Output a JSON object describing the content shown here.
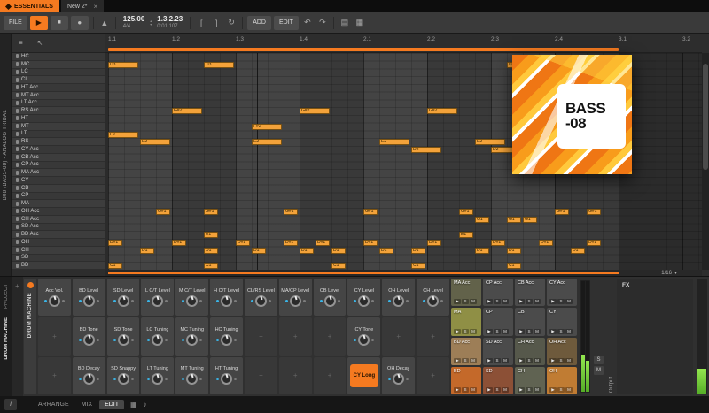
{
  "titlebar": {
    "badge": "ESSENTIALS",
    "tab": "New 2*",
    "close_glyph": "×"
  },
  "transport": {
    "file": "FILE",
    "play_glyph": "▶",
    "stop_glyph": "■",
    "record_glyph": "●",
    "metronome_glyph": "▲",
    "tempo": "125.00",
    "time_signature": "4/4",
    "position": "1.3.2.23",
    "time": "0:01.107",
    "punch_in_glyph": "[",
    "punch_out_glyph": "]",
    "loop_glyph": "↻",
    "add": "ADD",
    "edit": "EDIT",
    "undo_glyph": "↶",
    "redo_glyph": "↷",
    "layers_glyph": "▤",
    "grid_glyph": "▦",
    "stepper_up": "▴",
    "stepper_down": "▾"
  },
  "edit_view": {
    "track_vertical_label": "B08 (BASS-08) - ANALOG TRIBAL",
    "corner_menu_glyph": "≡",
    "corner_tool_glyph": "↖",
    "timeline": [
      "1.1",
      "1.2",
      "1.3",
      "1.4",
      "2.1",
      "2.2",
      "2.3",
      "2.4",
      "3.1",
      "3.2"
    ],
    "grid_value": "1/16",
    "grid_chevron": "▾",
    "lanes": [
      "HC",
      "MC",
      "LC",
      "CL",
      "HT Acc",
      "MT Acc",
      "LT Acc",
      "RS Acc",
      "HT",
      "MT",
      "LT",
      "RS",
      "CY Acc",
      "CB Acc",
      "CP Acc",
      "MA Acc",
      "CY",
      "CB",
      "CP",
      "MA",
      "OH Acc",
      "CH Acc",
      "SD Acc",
      "BD Acc",
      "OH",
      "CH",
      "SD",
      "BD"
    ],
    "notes": [
      {
        "label": "D3",
        "row": 1,
        "col": 0,
        "len": 2
      },
      {
        "label": "D3",
        "row": 1,
        "col": 6,
        "len": 2
      },
      {
        "label": "D3",
        "row": 1,
        "col": 25,
        "len": 2
      },
      {
        "label": "G#2",
        "row": 7,
        "col": 4,
        "len": 2
      },
      {
        "label": "G#2",
        "row": 7,
        "col": 12,
        "len": 2
      },
      {
        "label": "G#2",
        "row": 7,
        "col": 20,
        "len": 2
      },
      {
        "label": "F#2",
        "row": 9,
        "col": 9,
        "len": 2
      },
      {
        "label": "F2",
        "row": 10,
        "col": 0,
        "len": 2
      },
      {
        "label": "E2",
        "row": 11,
        "col": 2,
        "len": 2
      },
      {
        "label": "E2",
        "row": 11,
        "col": 9,
        "len": 2
      },
      {
        "label": "E2",
        "row": 11,
        "col": 17,
        "len": 2
      },
      {
        "label": "E2",
        "row": 11,
        "col": 23,
        "len": 2
      },
      {
        "label": "D2",
        "row": 12,
        "col": 19,
        "len": 2
      },
      {
        "label": "D2",
        "row": 12,
        "col": 24,
        "len": 2
      },
      {
        "label": "G#1",
        "row": 20,
        "col": 3,
        "len": 1
      },
      {
        "label": "G#1",
        "row": 20,
        "col": 6,
        "len": 1
      },
      {
        "label": "G#1",
        "row": 20,
        "col": 11,
        "len": 1
      },
      {
        "label": "G#1",
        "row": 20,
        "col": 16,
        "len": 1
      },
      {
        "label": "G#1",
        "row": 20,
        "col": 22,
        "len": 1
      },
      {
        "label": "G#1",
        "row": 20,
        "col": 28,
        "len": 1
      },
      {
        "label": "G#1",
        "row": 20,
        "col": 30,
        "len": 1
      },
      {
        "label": "G1",
        "row": 21,
        "col": 23,
        "len": 1
      },
      {
        "label": "G1",
        "row": 21,
        "col": 25,
        "len": 1
      },
      {
        "label": "G1",
        "row": 21,
        "col": 26,
        "len": 1
      },
      {
        "label": "E1",
        "row": 23,
        "col": 6,
        "len": 1
      },
      {
        "label": "E1",
        "row": 23,
        "col": 22,
        "len": 1
      },
      {
        "label": "D#1",
        "row": 24,
        "col": 0,
        "len": 1
      },
      {
        "label": "D#1",
        "row": 24,
        "col": 4,
        "len": 1
      },
      {
        "label": "D#1",
        "row": 24,
        "col": 8,
        "len": 1
      },
      {
        "label": "D#1",
        "row": 24,
        "col": 11,
        "len": 1
      },
      {
        "label": "D#1",
        "row": 24,
        "col": 13,
        "len": 1
      },
      {
        "label": "D#1",
        "row": 24,
        "col": 16,
        "len": 1
      },
      {
        "label": "D#1",
        "row": 24,
        "col": 20,
        "len": 1
      },
      {
        "label": "D#1",
        "row": 24,
        "col": 24,
        "len": 1
      },
      {
        "label": "D#1",
        "row": 24,
        "col": 27,
        "len": 1
      },
      {
        "label": "D#1",
        "row": 24,
        "col": 30,
        "len": 1
      },
      {
        "label": "D1",
        "row": 25,
        "col": 2,
        "len": 1
      },
      {
        "label": "D1",
        "row": 25,
        "col": 6,
        "len": 1
      },
      {
        "label": "D1",
        "row": 25,
        "col": 9,
        "len": 1
      },
      {
        "label": "D1",
        "row": 25,
        "col": 12,
        "len": 1
      },
      {
        "label": "D1",
        "row": 25,
        "col": 14,
        "len": 1
      },
      {
        "label": "D1",
        "row": 25,
        "col": 17,
        "len": 1
      },
      {
        "label": "D1",
        "row": 25,
        "col": 19,
        "len": 1
      },
      {
        "label": "D1",
        "row": 25,
        "col": 23,
        "len": 1
      },
      {
        "label": "D1",
        "row": 25,
        "col": 25,
        "len": 1
      },
      {
        "label": "D1",
        "row": 25,
        "col": 29,
        "len": 1
      },
      {
        "label": "C1",
        "row": 27,
        "col": 0,
        "len": 1
      },
      {
        "label": "C1",
        "row": 27,
        "col": 6,
        "len": 1
      },
      {
        "label": "C1",
        "row": 27,
        "col": 14,
        "len": 1
      },
      {
        "label": "C1",
        "row": 27,
        "col": 19,
        "len": 1
      },
      {
        "label": "C1",
        "row": 27,
        "col": 25,
        "len": 1
      }
    ]
  },
  "artwork": {
    "line1": "BASS",
    "line2": "-08"
  },
  "device_panel": {
    "side_tabs": [
      {
        "label": "PROJECT",
        "active": false
      },
      {
        "label": "DRUM MACHINE",
        "active": true
      }
    ],
    "chain_add_glyph": "+",
    "device_name": "DRUM MACHINE",
    "knob_rows": [
      [
        {
          "t": "knob",
          "label": "Acc Vol."
        },
        {
          "t": "knob",
          "label": "BD Level"
        },
        {
          "t": "knob",
          "label": "SD Level"
        },
        {
          "t": "knob",
          "label": "L C/T Level"
        },
        {
          "t": "knob",
          "label": "M C/T Level"
        },
        {
          "t": "knob",
          "label": "H C/T Level"
        },
        {
          "t": "knob",
          "label": "CL/RS Level"
        },
        {
          "t": "knob",
          "label": "MA/CP Level"
        },
        {
          "t": "knob",
          "label": "CB Level"
        },
        {
          "t": "knob",
          "label": "CY Level"
        },
        {
          "t": "knob",
          "label": "OH Level"
        },
        {
          "t": "knob",
          "label": "CH Level"
        }
      ],
      [
        {
          "t": "plus"
        },
        {
          "t": "knob",
          "label": "BD Tone"
        },
        {
          "t": "knob",
          "label": "SD Tone"
        },
        {
          "t": "knob",
          "label": "LC Tuning"
        },
        {
          "t": "knob",
          "label": "MC Tuning"
        },
        {
          "t": "knob",
          "label": "HC Tuning"
        },
        {
          "t": "plus"
        },
        {
          "t": "plus"
        },
        {
          "t": "plus"
        },
        {
          "t": "knob",
          "label": "CY Tone"
        },
        {
          "t": "plus"
        },
        {
          "t": "plus"
        }
      ],
      [
        {
          "t": "plus"
        },
        {
          "t": "knob",
          "label": "BD Decay"
        },
        {
          "t": "knob",
          "label": "SD Snappy"
        },
        {
          "t": "knob",
          "label": "LT Tuning"
        },
        {
          "t": "knob",
          "label": "MT Tuning"
        },
        {
          "t": "knob",
          "label": "HT Tuning"
        },
        {
          "t": "plus"
        },
        {
          "t": "plus"
        },
        {
          "t": "plus"
        },
        {
          "t": "button",
          "label": "CY Long"
        },
        {
          "t": "knob",
          "label": "OH Decay"
        },
        {
          "t": "plus"
        }
      ]
    ],
    "pads": [
      {
        "label": "MA Acc",
        "color": "#62624a"
      },
      {
        "label": "CP Acc",
        "color": "#4b4b4b"
      },
      {
        "label": "CB Acc",
        "color": "#4b4b4b"
      },
      {
        "label": "CY Acc",
        "color": "#4b4b4b"
      },
      {
        "label": "MA",
        "color": "#8f8f45"
      },
      {
        "label": "CP",
        "color": "#4b4b4b"
      },
      {
        "label": "CB",
        "color": "#4b4b4b"
      },
      {
        "label": "CY",
        "color": "#4b4b4b"
      },
      {
        "label": "BD Acc",
        "color": "#9d7e57"
      },
      {
        "label": "SD Acc",
        "color": "#4b4b4b"
      },
      {
        "label": "CH Acc",
        "color": "#56584b"
      },
      {
        "label": "OH Acc",
        "color": "#6e5a3c"
      },
      {
        "label": "BD",
        "color": "#c4692a"
      },
      {
        "label": "SD",
        "color": "#8c5036"
      },
      {
        "label": "CH",
        "color": "#606352"
      },
      {
        "label": "OH",
        "color": "#c07c33"
      }
    ],
    "pad_controls": {
      "play": "▶",
      "solo": "S",
      "mute": "M"
    },
    "solo": "S",
    "mute": "M",
    "output": "Output",
    "fx": "FX"
  },
  "statusbar": {
    "info_glyph": "i",
    "tabs": [
      {
        "label": "ARRANGE",
        "active": false
      },
      {
        "label": "MIX",
        "active": false
      },
      {
        "label": "EDIT",
        "active": true
      }
    ],
    "icon1_glyph": "▦",
    "icon2_glyph": "♪"
  },
  "colors": {
    "accent": "#f57a20",
    "note_fill": "#f3a23a",
    "meter_green": "#7ade39"
  }
}
